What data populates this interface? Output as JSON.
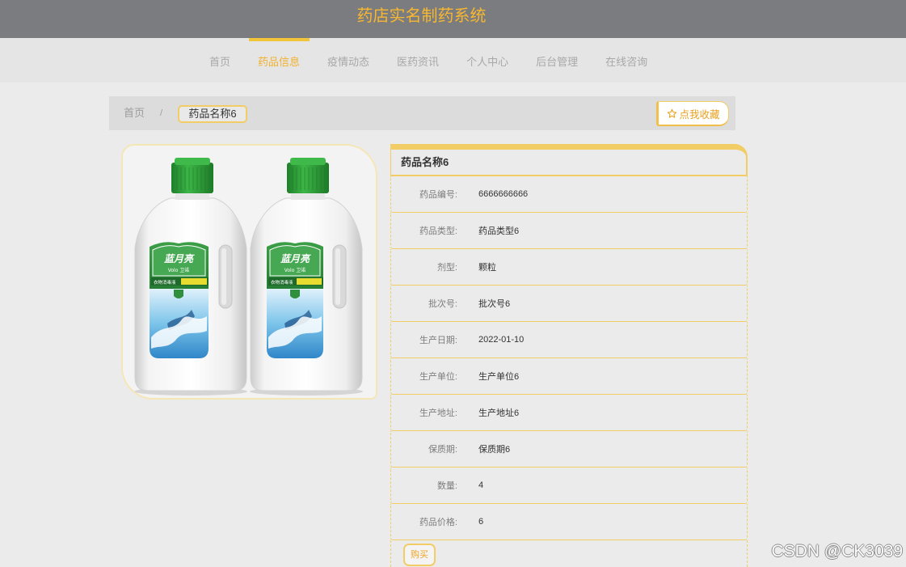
{
  "header": {
    "title": "药店实名制药系统"
  },
  "nav": {
    "items": [
      {
        "label": "首页",
        "active": false
      },
      {
        "label": "药品信息",
        "active": true
      },
      {
        "label": "疫情动态",
        "active": false
      },
      {
        "label": "医药资讯",
        "active": false
      },
      {
        "label": "个人中心",
        "active": false
      },
      {
        "label": "后台管理",
        "active": false
      },
      {
        "label": "在线咨询",
        "active": false
      }
    ]
  },
  "breadcrumb": {
    "home": "首页",
    "separator": "/",
    "current": "药品名称6"
  },
  "favorite_button": {
    "icon": "star-icon",
    "label": "点我收藏"
  },
  "product_image": {
    "brand": "蓝月亮",
    "sub_brand": "Volo 卫诺",
    "product_type": "衣物消毒液"
  },
  "detail": {
    "title": "药品名称6",
    "fields": [
      {
        "label": "药品编号:",
        "value": "6666666666"
      },
      {
        "label": "药品类型:",
        "value": "药品类型6"
      },
      {
        "label": "剂型:",
        "value": "颗粒"
      },
      {
        "label": "批次号:",
        "value": "批次号6"
      },
      {
        "label": "生产日期:",
        "value": "2022-01-10"
      },
      {
        "label": "生产单位:",
        "value": "生产单位6"
      },
      {
        "label": "生产地址:",
        "value": "生产地址6"
      },
      {
        "label": "保质期:",
        "value": "保质期6"
      },
      {
        "label": "数量:",
        "value": "4"
      },
      {
        "label": "药品价格:",
        "value": "6"
      }
    ],
    "buy_label": "购买"
  },
  "watermark": "CSDN @CK3039",
  "colors": {
    "header_bg": "#7b7c7f",
    "accent": "#f2b12e",
    "border_accent": "#f2cd66",
    "page_bg": "#ebebeb"
  }
}
